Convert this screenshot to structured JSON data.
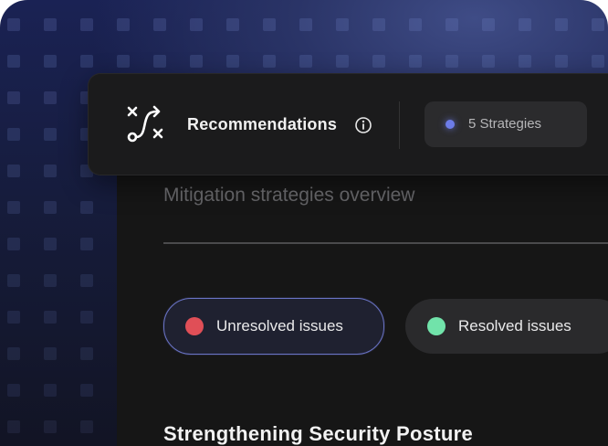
{
  "header": {
    "title": "Recommendations",
    "route_icon": "route-shuffle-icon",
    "info_icon": "info-icon",
    "badge_label": "5 Strategies"
  },
  "main": {
    "subtitle": "Mitigation strategies overview",
    "filters": [
      {
        "label": "Unresolved issues",
        "color": "#e04f57",
        "selected": true
      },
      {
        "label": "Resolved issues",
        "color": "#71e3aa",
        "selected": false
      }
    ],
    "section_title": "Strengthening Security Posture"
  },
  "colors": {
    "accent": "#6d7ce8",
    "unresolved": "#e04f57",
    "resolved": "#71e3aa"
  }
}
